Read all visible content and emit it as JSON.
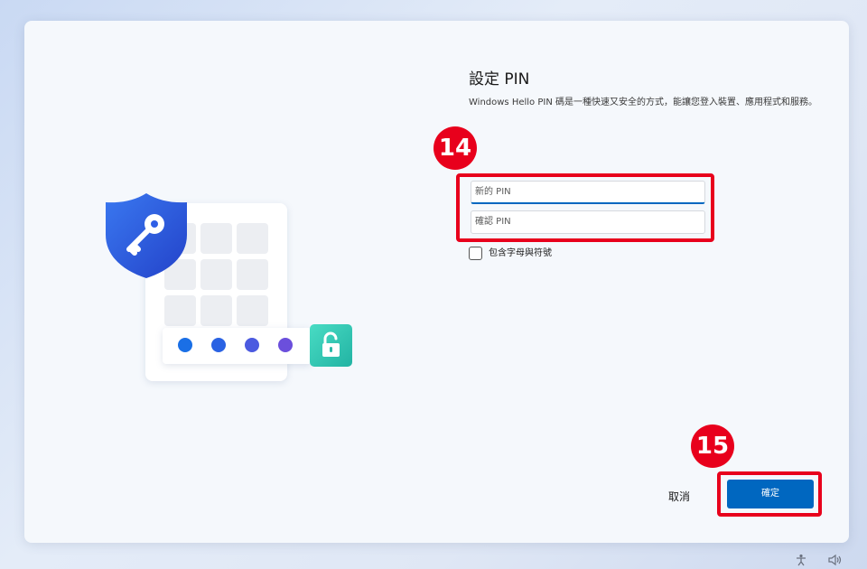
{
  "setup": {
    "title": "設定 PIN",
    "description": "Windows Hello PIN 碼是一種快速又安全的方式，能讓您登入裝置、應用程式和服務。",
    "new_pin_placeholder": "新的 PIN",
    "confirm_pin_placeholder": "確認 PIN",
    "include_letters_label": "包含字母與符號",
    "include_letters_checked": false,
    "cancel_label": "取消",
    "ok_label": "確定"
  },
  "annotations": {
    "step_inputs": "14",
    "step_ok": "15"
  },
  "colors": {
    "accent": "#0067c0",
    "annotation_red": "#e8001c",
    "shield_blue": "#2f5fe6",
    "unlock_teal": "#2fc9b4",
    "pin_dots": [
      "#1a6fe6",
      "#2a62e3",
      "#4b5ae0",
      "#6b4fdc"
    ]
  },
  "icons": {
    "shield": "shield-key-icon",
    "unlock": "unlock-icon",
    "tray_1": "accessibility-icon",
    "tray_2": "volume-icon"
  }
}
